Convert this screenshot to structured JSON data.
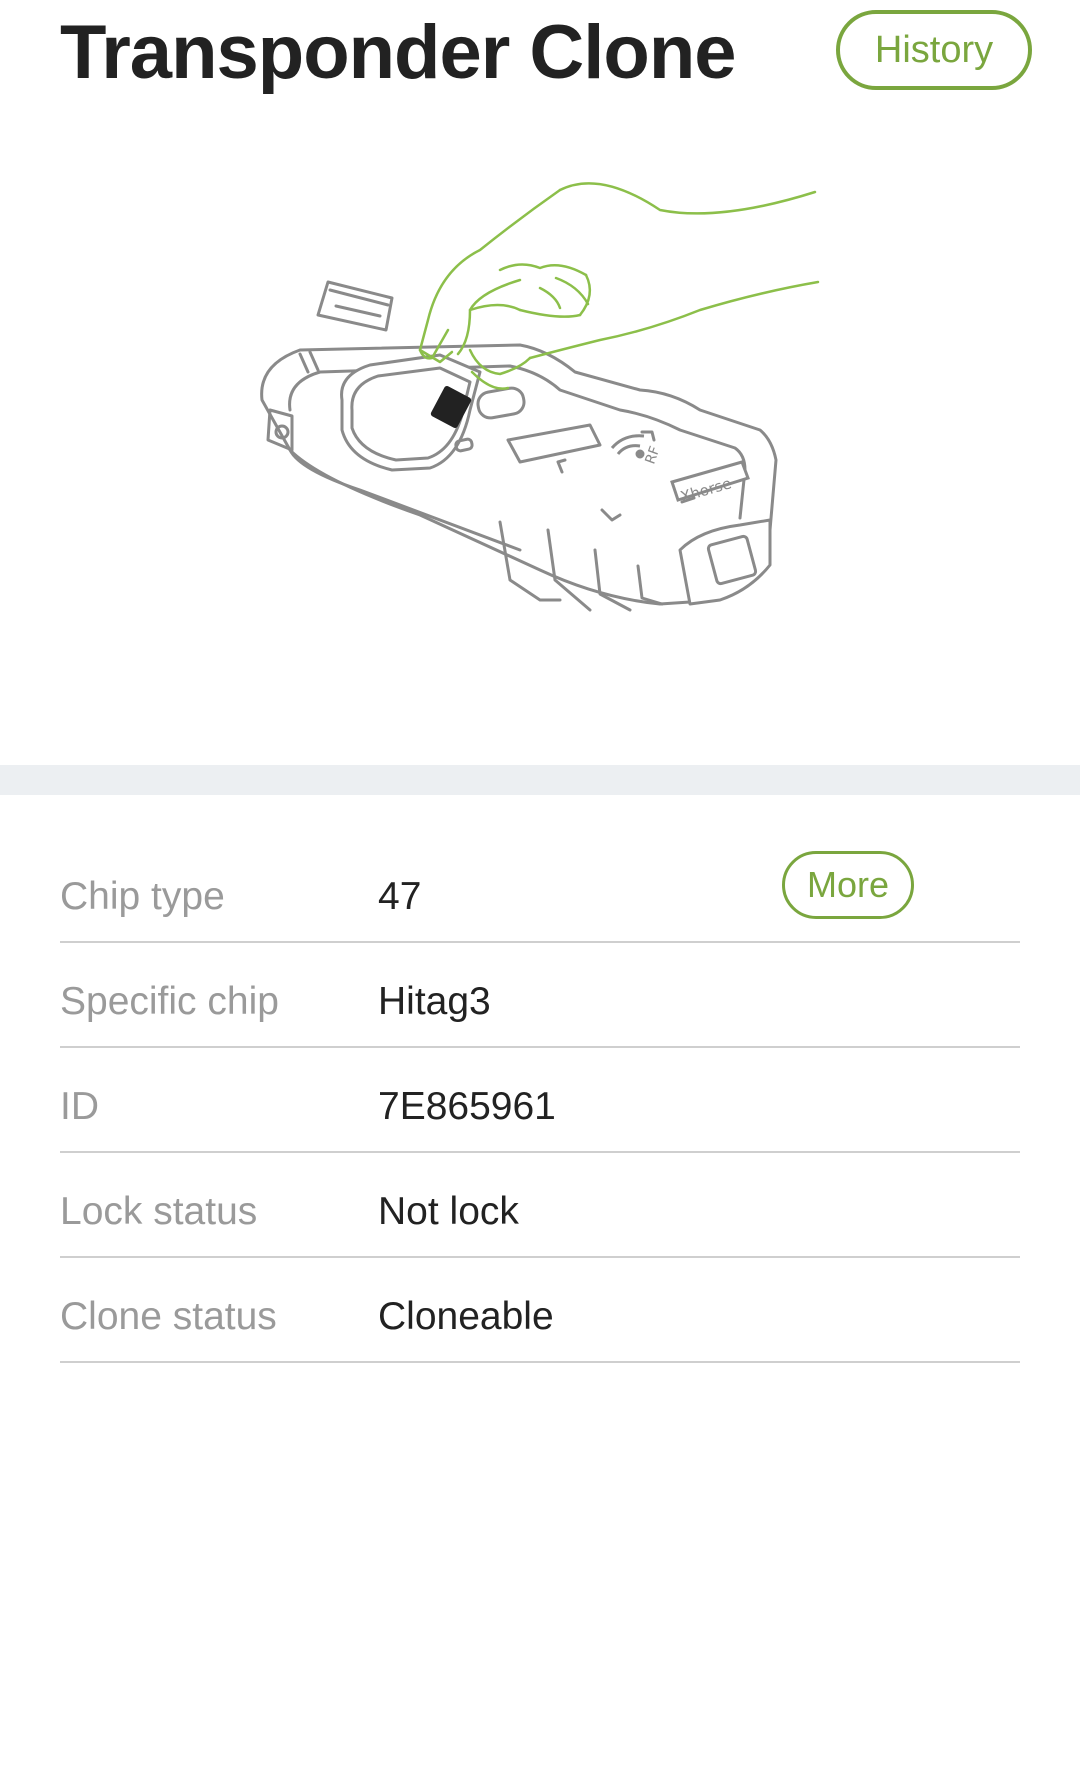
{
  "header": {
    "title": "Transponder Clone",
    "history_label": "History"
  },
  "illustration": {
    "device_brand": "Xhorse",
    "rf_label": "RF",
    "icons": [
      "hand-icon",
      "transponder-chip-icon",
      "key-tool-device-icon",
      "rf-signal-icon"
    ]
  },
  "details": {
    "more_label": "More",
    "rows": [
      {
        "label": "Chip type",
        "value": "47"
      },
      {
        "label": "Specific chip",
        "value": "Hitag3"
      },
      {
        "label": "ID",
        "value": "7E865961"
      },
      {
        "label": "Lock status",
        "value": "Not lock"
      },
      {
        "label": "Clone status",
        "value": "Cloneable"
      }
    ]
  },
  "colors": {
    "accent": "#7aa63e",
    "title": "#222222",
    "label": "#9a9a9a",
    "divider_band": "#eceff2",
    "row_border": "#cfcfcf"
  }
}
